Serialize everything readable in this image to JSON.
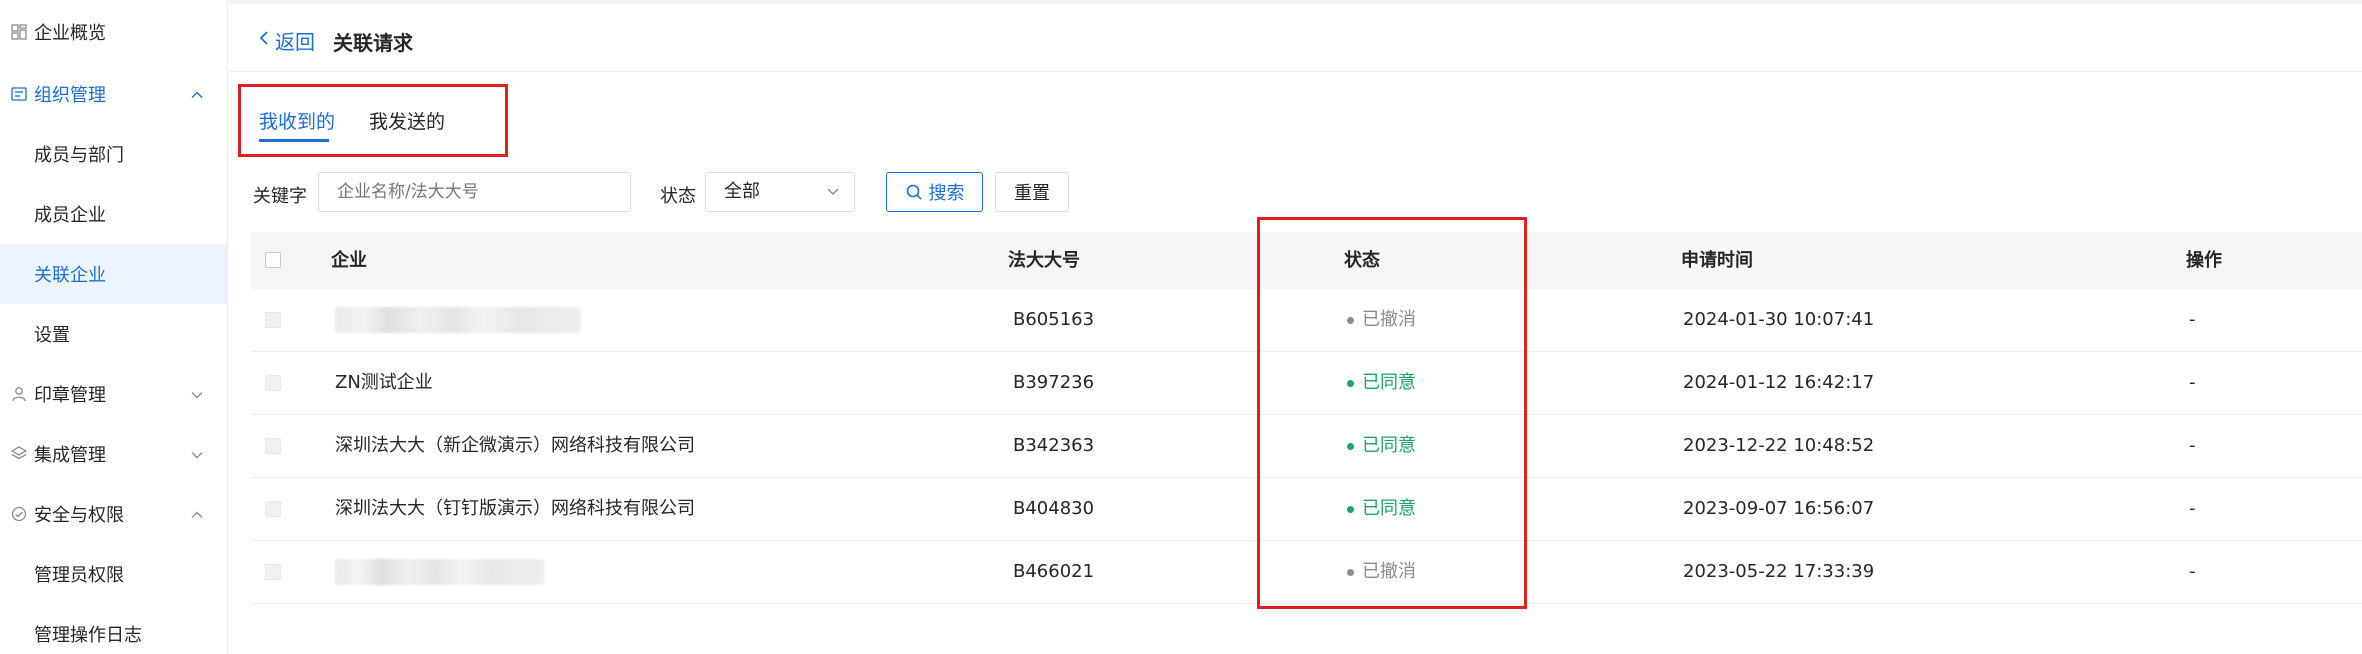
{
  "sidebar": {
    "items": [
      {
        "label": "企业概览",
        "icon": "dashboard-icon"
      },
      {
        "label": "组织管理",
        "icon": "org-icon",
        "expanded": true
      },
      {
        "label": "成员与部门"
      },
      {
        "label": "成员企业"
      },
      {
        "label": "关联企业",
        "active": true
      },
      {
        "label": "设置"
      },
      {
        "label": "印章管理",
        "icon": "seal-user-icon"
      },
      {
        "label": "集成管理",
        "icon": "layers-icon"
      },
      {
        "label": "安全与权限",
        "icon": "shield-icon",
        "expanded": true
      },
      {
        "label": "管理员权限"
      },
      {
        "label": "管理操作日志"
      }
    ]
  },
  "header": {
    "back_label": "返回",
    "title": "关联请求"
  },
  "tabs": [
    {
      "label": "我收到的",
      "active": true
    },
    {
      "label": "我发送的",
      "active": false
    }
  ],
  "filter": {
    "keyword_label": "关键字",
    "keyword_placeholder": "企业名称/法大大号",
    "status_label": "状态",
    "status_value": "全部",
    "search_label": "搜索",
    "reset_label": "重置"
  },
  "table": {
    "columns": [
      "企业",
      "法大大号",
      "状态",
      "申请时间",
      "操作"
    ],
    "rows": [
      {
        "company": "",
        "blurred": true,
        "account": "B605163",
        "status": "已撤消",
        "status_type": "revoked",
        "time": "2024-01-30 10:07:41",
        "action": "-"
      },
      {
        "company": "ZN测试企业",
        "blurred": false,
        "account": "B397236",
        "status": "已同意",
        "status_type": "agreed",
        "time": "2024-01-12 16:42:17",
        "action": "-"
      },
      {
        "company": "深圳法大大（新企微演示）网络科技有限公司",
        "blurred": false,
        "account": "B342363",
        "status": "已同意",
        "status_type": "agreed",
        "time": "2023-12-22 10:48:52",
        "action": "-"
      },
      {
        "company": "深圳法大大（钉钉版演示）网络科技有限公司",
        "blurred": false,
        "account": "B404830",
        "status": "已同意",
        "status_type": "agreed",
        "time": "2023-09-07 16:56:07",
        "action": "-"
      },
      {
        "company": "",
        "blurred": true,
        "account": "B466021",
        "status": "已撤消",
        "status_type": "revoked",
        "time": "2023-05-22 17:33:39",
        "action": "-"
      }
    ]
  },
  "colors": {
    "accent": "#1a6fd8",
    "agreed": "#1aa56b",
    "revoked": "#8c8c8c",
    "highlight_box": "#e02020"
  }
}
